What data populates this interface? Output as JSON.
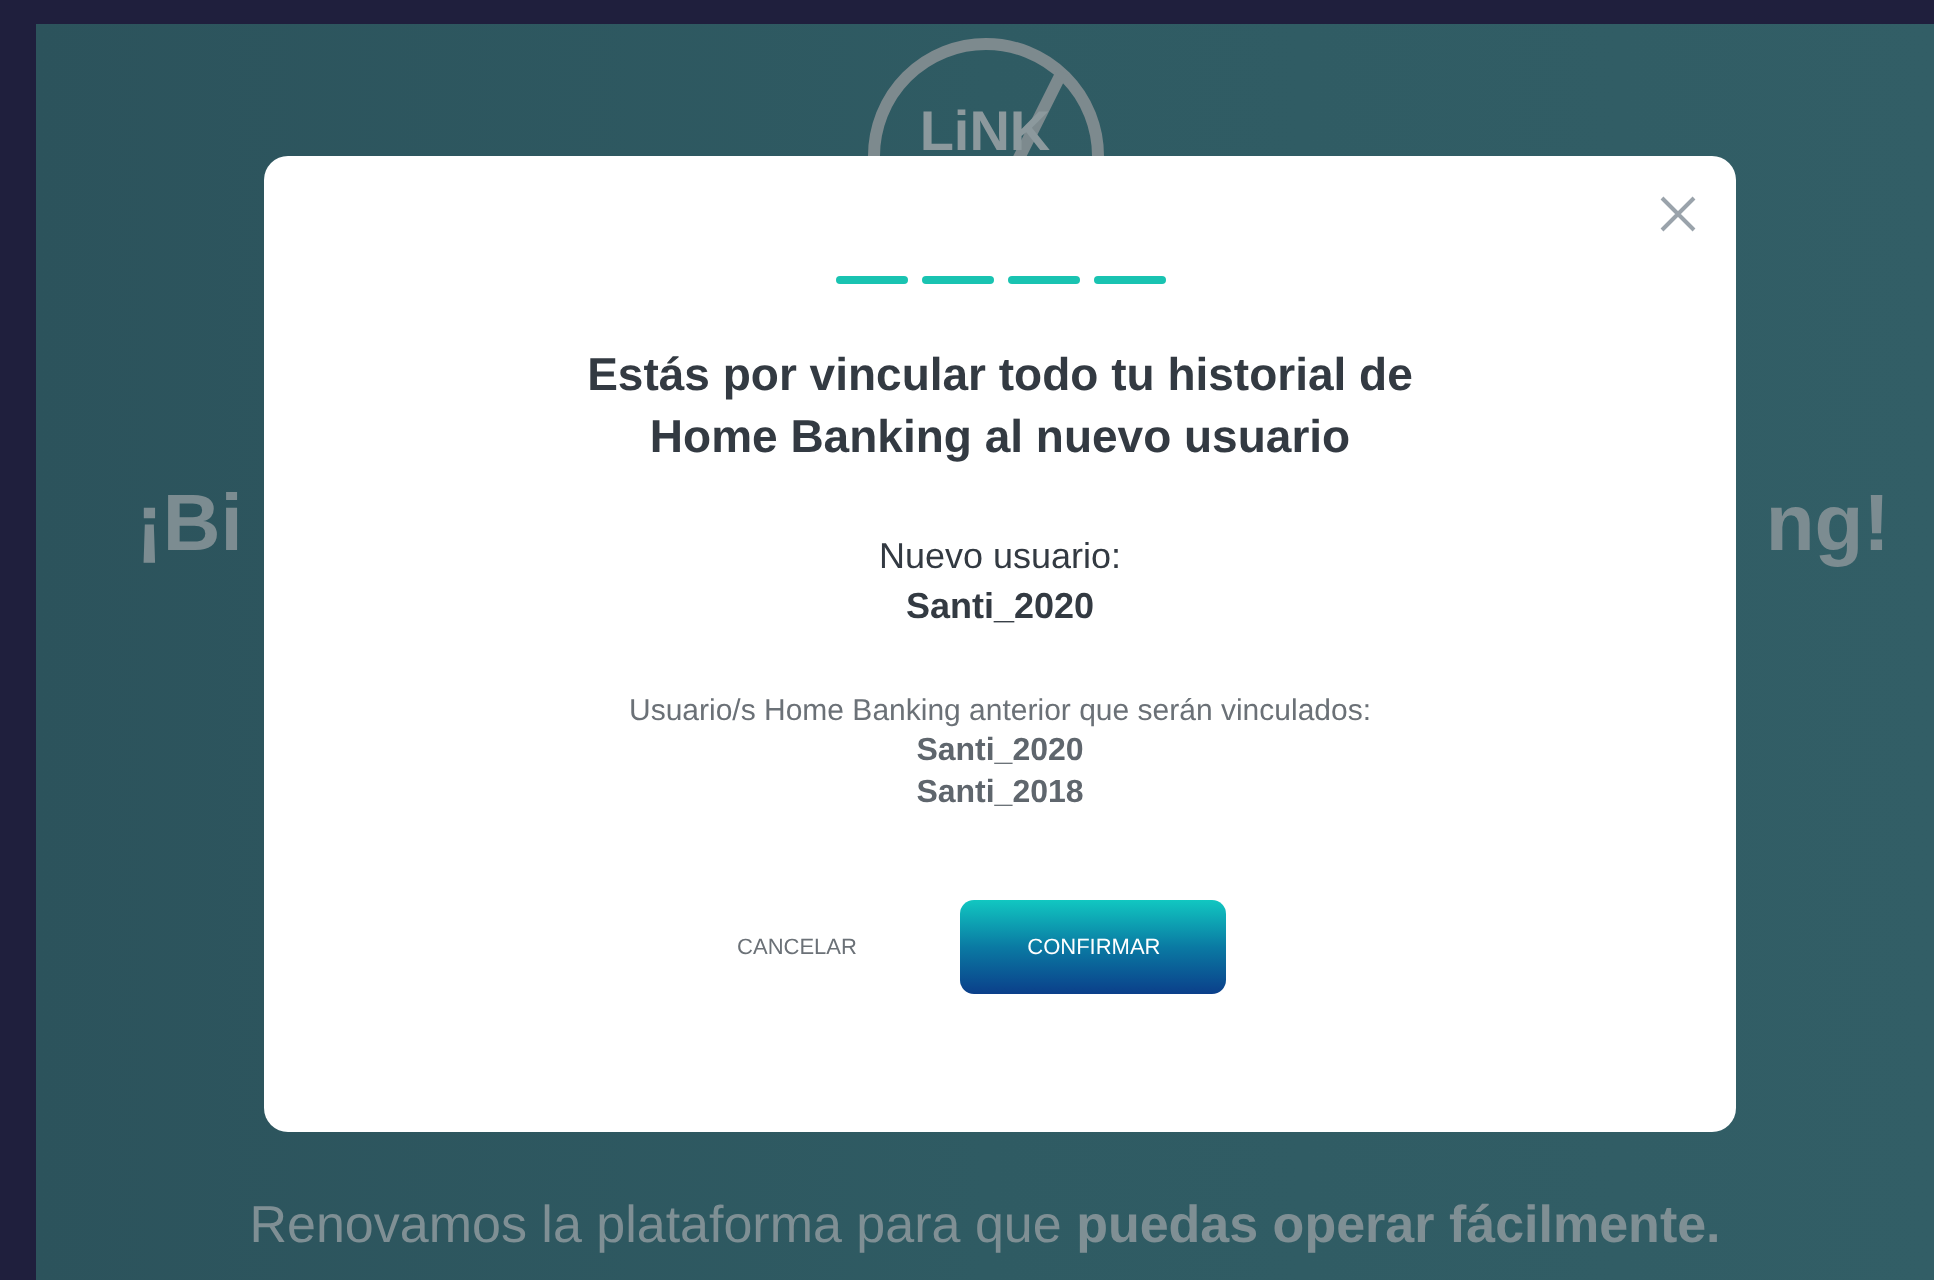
{
  "background": {
    "logo": "LiNK",
    "headline_left": "¡Bi",
    "headline_right": "ng!",
    "tagline": "Renovamos la plataforma para que **puedas operar fácilmente.**"
  },
  "dialog": {
    "steps": [
      {
        "completed": true
      },
      {
        "completed": true
      },
      {
        "completed": true
      },
      {
        "completed": true
      }
    ],
    "title": "Estás por vincular todo tu historial de Home Banking al nuevo usuario",
    "new_user_label": "Nuevo usuario:",
    "new_user": "Santi_2020",
    "linked_label": "Usuario/s Home Banking anterior que serán vinculados:",
    "linked_users": [
      "Santi_2020",
      "Santi_2018"
    ],
    "buttons": {
      "cancel": "CANCELAR",
      "confirm": "CONFIRMAR"
    }
  }
}
